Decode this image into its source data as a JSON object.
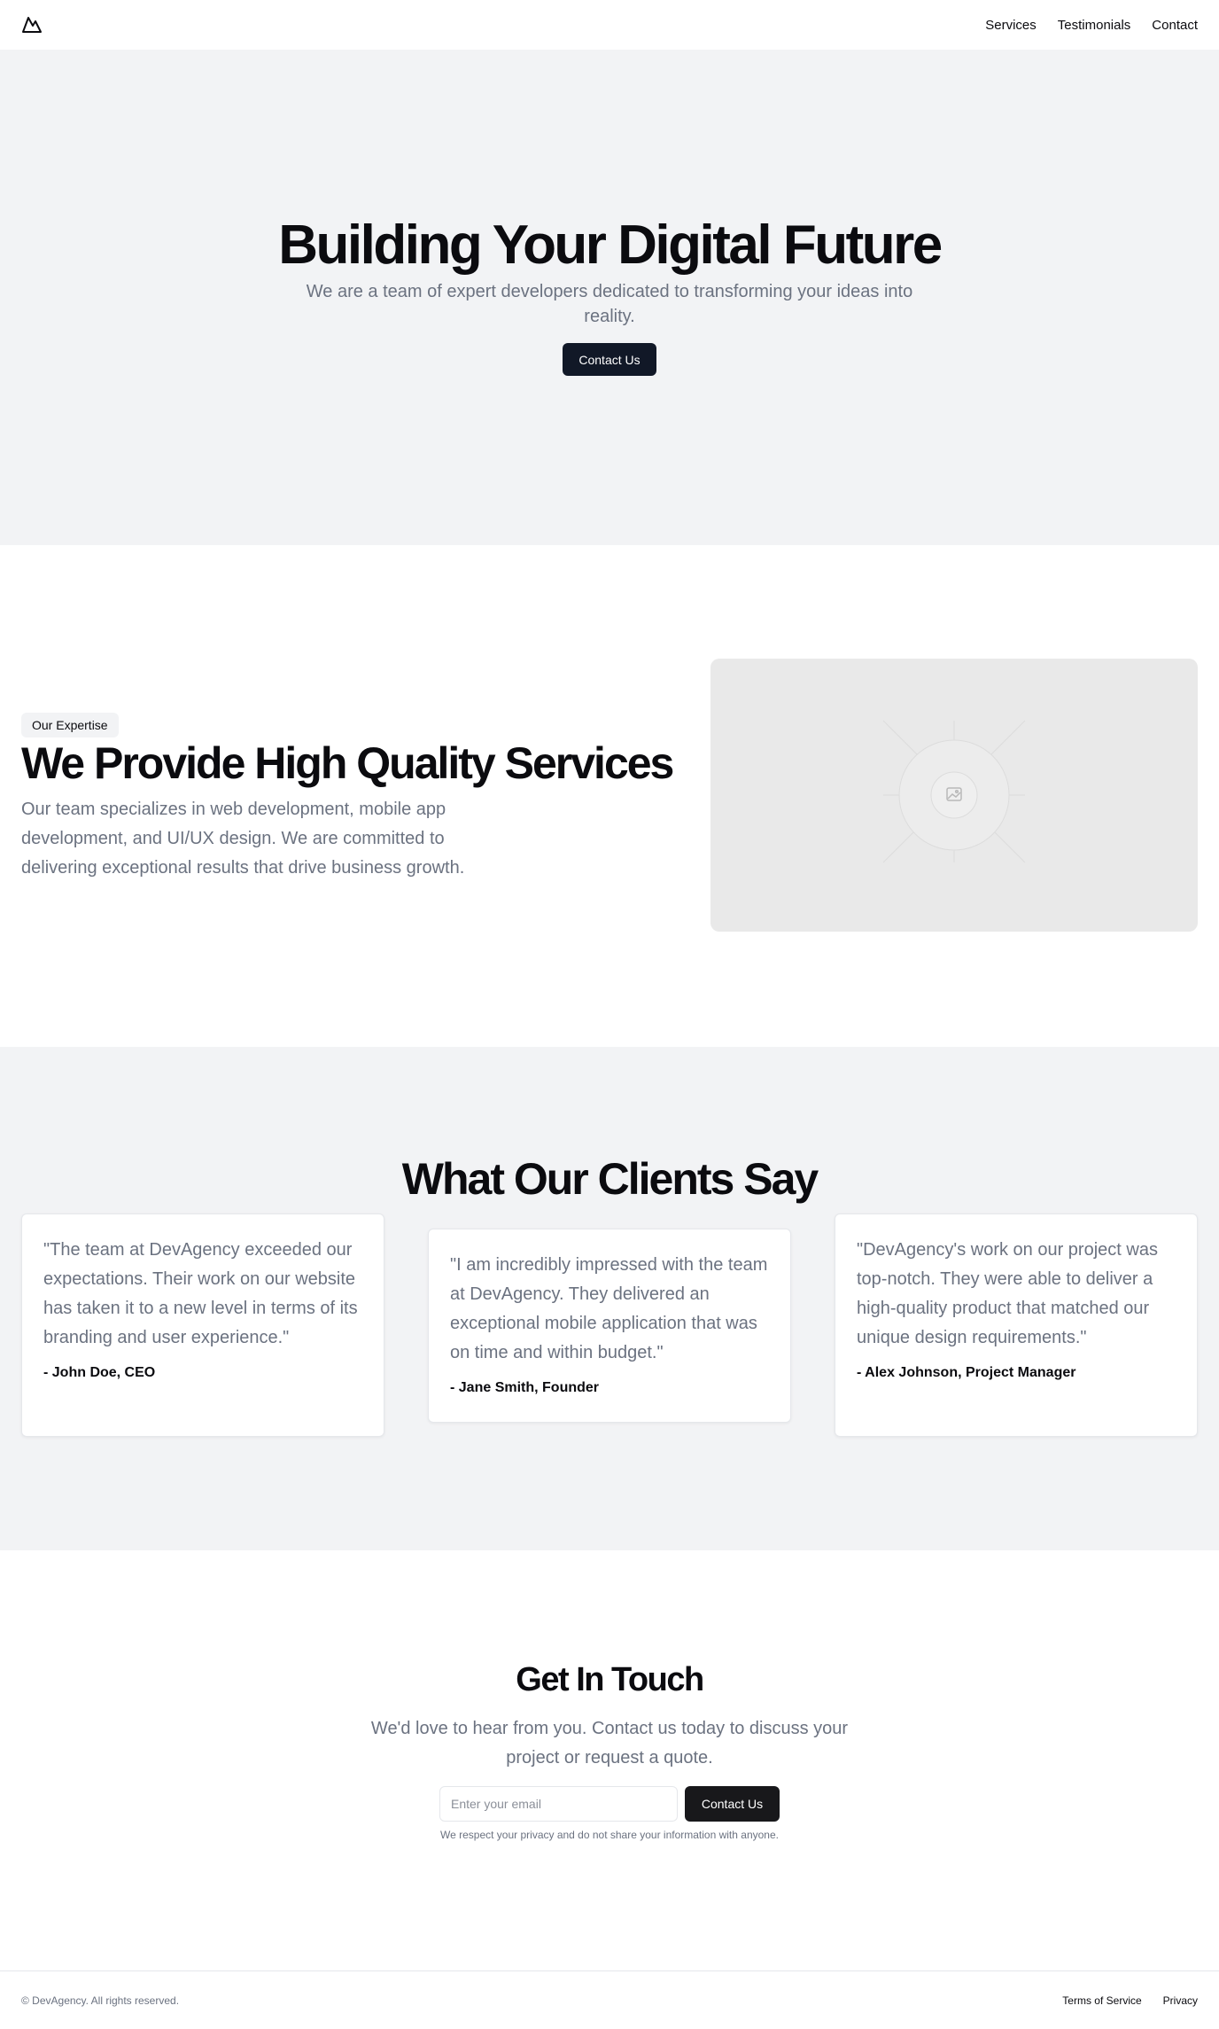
{
  "nav": {
    "links": [
      "Services",
      "Testimonials",
      "Contact"
    ]
  },
  "hero": {
    "title": "Building Your Digital Future",
    "subtitle": "We are a team of expert developers dedicated to transforming your ideas into reality.",
    "cta_label": "Contact Us"
  },
  "services": {
    "badge": "Our Expertise",
    "title": "We Provide High Quality Services",
    "description": "Our team specializes in web development, mobile app development, and UI/UX design. We are committed to delivering exceptional results that drive business growth.",
    "image_icon": "image-icon"
  },
  "testimonials": {
    "title": "What Our Clients Say",
    "items": [
      {
        "quote": "\"The team at DevAgency exceeded our expectations. Their work on our website has taken it to a new level in terms of its branding and user experience.\"",
        "author": "- John Doe, CEO"
      },
      {
        "quote": "\"I am incredibly impressed with the team at DevAgency. They delivered an exceptional mobile application that was on time and within budget.\"",
        "author": "- Jane Smith, Founder"
      },
      {
        "quote": "\"DevAgency's work on our project was top-notch. They were able to deliver a high-quality product that matched our unique design requirements.\"",
        "author": "- Alex Johnson, Project Manager"
      }
    ]
  },
  "contact": {
    "title": "Get In Touch",
    "subtitle": "We'd love to hear from you. Contact us today to discuss your project or request a quote.",
    "email_placeholder": "Enter your email",
    "button_label": "Contact Us",
    "privacy_note": "We respect your privacy and do not share your information with anyone."
  },
  "footer": {
    "copyright": "© DevAgency. All rights reserved.",
    "links": [
      "Terms of Service",
      "Privacy"
    ]
  },
  "colors": {
    "primary_button": "#111827",
    "section_gray": "#f2f3f5",
    "muted_text": "#6b7280"
  }
}
